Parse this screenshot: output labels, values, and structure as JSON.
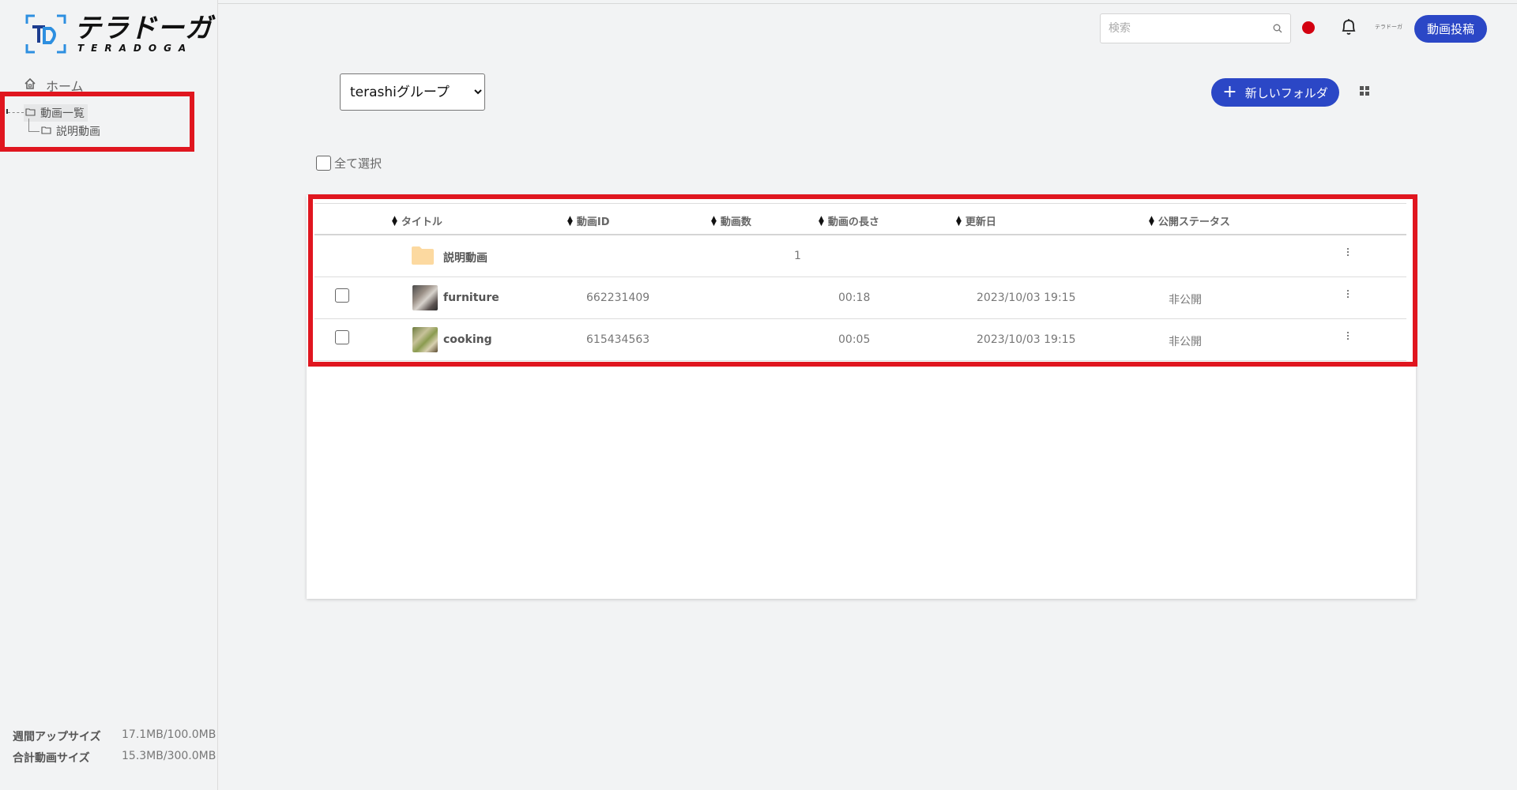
{
  "app": {
    "logo_jp": "テラドーガ",
    "logo_en": "TERADOGA",
    "brand_mini": "テラドーガ"
  },
  "sidebar": {
    "home": "ホーム",
    "tree": {
      "root": "動画一覧",
      "child": "説明動画"
    },
    "usage": [
      {
        "label": "週間アップサイズ",
        "value": "17.1MB/100.0MB"
      },
      {
        "label": "合計動画サイズ",
        "value": "15.3MB/300.0MB"
      }
    ]
  },
  "header": {
    "search_placeholder": "検索",
    "upload_label": "動画投稿"
  },
  "toolbar": {
    "group_selected": "terashiグループ",
    "new_folder_label": "新しいフォルダ",
    "select_all_label": "全て選択"
  },
  "table": {
    "headers": {
      "title": "タイトル",
      "video_id": "動画ID",
      "count": "動画数",
      "length": "動画の長さ",
      "updated": "更新日",
      "status": "公開ステータス"
    },
    "folder_row": {
      "title": "説明動画",
      "count": "1"
    },
    "rows": [
      {
        "title": "furniture",
        "video_id": "662231409",
        "length": "00:18",
        "updated": "2023/10/03 19:15",
        "status": "非公開"
      },
      {
        "title": "cooking",
        "video_id": "615434563",
        "length": "00:05",
        "updated": "2023/10/03 19:15",
        "status": "非公開"
      }
    ]
  },
  "colors": {
    "accent": "#2b47c6",
    "highlight": "#e0161f",
    "record": "#d30010",
    "folder": "#fcd9a0"
  }
}
